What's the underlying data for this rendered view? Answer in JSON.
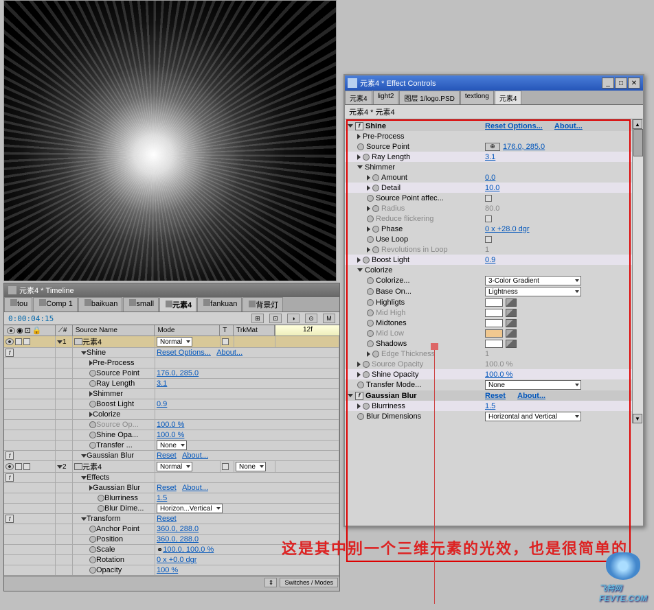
{
  "preview": {
    "marker_icon": "✕"
  },
  "timeline": {
    "title": "元素4 * Timeline",
    "tabs": [
      "tou",
      "Comp 1",
      "baikuan",
      "small",
      "元素4",
      "fankuan",
      "背景灯"
    ],
    "active_tab": "元素4",
    "timecode": "0:00:04:15",
    "ruler_mark": "12f",
    "header": {
      "c3": "Source Name",
      "c4": "Mode",
      "c5": "T",
      "c6": "TrkMat"
    },
    "footer_btn": "Switches / Modes",
    "layers": [
      {
        "idx": "1",
        "name": "元素4",
        "mode": "Normal",
        "sel": true,
        "children": [
          {
            "name": "Shine",
            "val_reset": "Reset Options...",
            "val_about": "About...",
            "children": [
              {
                "name": "Pre-Process"
              },
              {
                "name": "Source Point",
                "val": "176.0, 285.0",
                "watch": true
              },
              {
                "name": "Ray Length",
                "val": "3.1",
                "watch": true
              },
              {
                "name": "Shimmer"
              },
              {
                "name": "Boost Light",
                "val": "0.9",
                "watch": true
              },
              {
                "name": "Colorize"
              },
              {
                "name": "Source Op...",
                "val": "100.0 %",
                "dis": true,
                "watch": true
              },
              {
                "name": "Shine Opa...",
                "val": "100.0 %",
                "watch": true
              },
              {
                "name": "Transfer ...",
                "dropdown": "None",
                "watch": true
              }
            ]
          },
          {
            "name": "Gaussian Blur",
            "val_reset": "Reset",
            "val_about": "About..."
          }
        ]
      },
      {
        "idx": "2",
        "name": "元素4",
        "mode": "Normal",
        "trkmat": "None",
        "children": [
          {
            "name": "Effects",
            "children": [
              {
                "name": "Gaussian Blur",
                "val_reset": "Reset",
                "val_about": "About...",
                "children": [
                  {
                    "name": "Blurriness",
                    "val": "1.5",
                    "watch": true
                  },
                  {
                    "name": "Blur Dime...",
                    "dropdown": "Horizon...Vertical",
                    "watch": true
                  }
                ]
              }
            ]
          },
          {
            "name": "Transform",
            "val_reset": "Reset",
            "children": [
              {
                "name": "Anchor Point",
                "val": "360.0, 288.0",
                "watch": true
              },
              {
                "name": "Position",
                "val": "360.0, 288.0",
                "watch": true
              },
              {
                "name": "Scale",
                "val": "100.0, 100.0 %",
                "watch": true,
                "chain": true
              },
              {
                "name": "Rotation",
                "val": "0 x +0.0 dgr",
                "watch": true
              },
              {
                "name": "Opacity",
                "val": "100 %",
                "watch": true
              }
            ]
          }
        ]
      }
    ]
  },
  "effect_controls": {
    "title": "元素4 * Effect Controls",
    "tabs": [
      "元素4",
      "light2",
      "图层 1/logo.PSD",
      "textlong",
      "元素4"
    ],
    "active_tab_idx": 4,
    "subtitle": "元素4 * 元素4",
    "effects": [
      {
        "name": "Shine",
        "reset": "Reset Options...",
        "about": "About...",
        "rows": [
          {
            "l": "Pre-Process",
            "tri": true
          },
          {
            "l": "Source Point",
            "v": "176.0, 285.0",
            "watch": true,
            "cross": true,
            "link": true
          },
          {
            "l": "Ray Length",
            "v": "3.1",
            "tri": true,
            "watch": true,
            "link": true,
            "alt": true
          },
          {
            "l": "Shimmer",
            "tri": true,
            "open": true
          },
          {
            "l": "Amount",
            "v": "0.0",
            "tri": true,
            "watch": true,
            "i": 1,
            "link": true
          },
          {
            "l": "Detail",
            "v": "10.0",
            "tri": true,
            "watch": true,
            "i": 1,
            "link": true,
            "alt": true
          },
          {
            "l": "Source Point affec...",
            "cb": true,
            "watch": true,
            "i": 1
          },
          {
            "l": "Radius",
            "v": "80.0",
            "tri": true,
            "watch": true,
            "i": 1,
            "dis": true
          },
          {
            "l": "Reduce flickering",
            "cb": true,
            "watch": true,
            "i": 1,
            "dis": true
          },
          {
            "l": "Phase",
            "v": "0 x +28.0 dgr",
            "tri": true,
            "watch": true,
            "i": 1,
            "link": true
          },
          {
            "l": "Use Loop",
            "cb": true,
            "watch": true,
            "i": 1
          },
          {
            "l": "Revolutions in Loop",
            "v": "1",
            "tri": true,
            "watch": true,
            "i": 1,
            "dis": true
          },
          {
            "l": "Boost Light",
            "v": "0.9",
            "tri": true,
            "watch": true,
            "link": true,
            "alt": true
          },
          {
            "l": "Colorize",
            "tri": true,
            "open": true
          },
          {
            "l": "Colorize...",
            "dd": "3-Color Gradient",
            "watch": true,
            "i": 1
          },
          {
            "l": "Base On...",
            "dd": "Lightness",
            "watch": true,
            "i": 1
          },
          {
            "l": "Highligts",
            "sw": "#ffffff",
            "watch": true,
            "i": 1
          },
          {
            "l": "Mid High",
            "sw": "#ffffff",
            "watch": true,
            "i": 1,
            "dis": true
          },
          {
            "l": "Midtones",
            "sw": "#ffffff",
            "watch": true,
            "i": 1
          },
          {
            "l": "Mid Low",
            "sw": "#f0c890",
            "watch": true,
            "i": 1,
            "dis": true
          },
          {
            "l": "Shadows",
            "sw": "#ffffff",
            "watch": true,
            "i": 1
          },
          {
            "l": "Edge Thickness",
            "v": "1",
            "tri": true,
            "watch": true,
            "i": 1,
            "dis": true
          },
          {
            "l": "Source Opacity",
            "v": "100.0 %",
            "tri": true,
            "watch": true,
            "dis": true
          },
          {
            "l": "Shine Opacity",
            "v": "100.0 %",
            "tri": true,
            "watch": true,
            "link": true,
            "alt": true
          },
          {
            "l": "Transfer Mode...",
            "dd": "None",
            "watch": true
          }
        ]
      },
      {
        "name": "Gaussian Blur",
        "reset": "Reset",
        "about": "About...",
        "rows": [
          {
            "l": "Blurriness",
            "v": "1.5",
            "tri": true,
            "watch": true,
            "link": true,
            "alt": true
          },
          {
            "l": "Blur Dimensions",
            "dd": "Horizontal and Vertical",
            "watch": true
          }
        ]
      }
    ]
  },
  "annotation": "这是其中别一个三维元素的光效，也是很简单的",
  "watermark": {
    "text": "飞特网",
    "url": "FEVTE.COM"
  }
}
